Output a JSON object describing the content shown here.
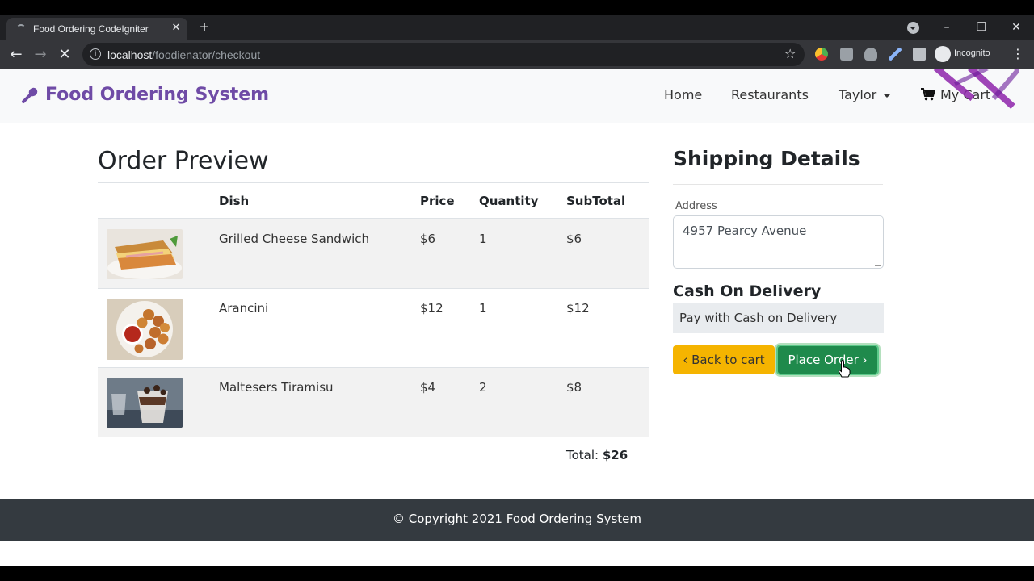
{
  "browser": {
    "tab_title": "Food Ordering CodeIgniter",
    "url_host": "localhost",
    "url_path": "/foodienator/checkout",
    "profile_label": "Incognito"
  },
  "site": {
    "brand": "Food Ordering System",
    "nav": {
      "home": "Home",
      "restaurants": "Restaurants",
      "user": "Taylor",
      "cart": "My Cart"
    }
  },
  "order": {
    "title": "Order Preview",
    "headers": {
      "dish": "Dish",
      "price": "Price",
      "quantity": "Quantity",
      "subtotal": "SubTotal"
    },
    "items": [
      {
        "dish": "Grilled Cheese Sandwich",
        "price": "$6",
        "quantity": "1",
        "subtotal": "$6"
      },
      {
        "dish": "Arancini",
        "price": "$12",
        "quantity": "1",
        "subtotal": "$12"
      },
      {
        "dish": "Maltesers Tiramisu",
        "price": "$4",
        "quantity": "2",
        "subtotal": "$8"
      }
    ],
    "total_label": "Total:",
    "total_value": "$26"
  },
  "shipping": {
    "title": "Shipping Details",
    "address_label": "Address",
    "address_value": "4957 Pearcy Avenue",
    "payment_title": "Cash On Delivery",
    "payment_value": "Pay with Cash on Delivery",
    "back_label": "Back to cart",
    "place_label": "Place Order"
  },
  "footer": {
    "copyright": "© Copyright 2021 Food Ordering System"
  },
  "colors": {
    "brand": "#6f4ba6",
    "place_order": "#1f8a4c",
    "back_to_cart": "#f5b400",
    "footer": "#343a40"
  }
}
